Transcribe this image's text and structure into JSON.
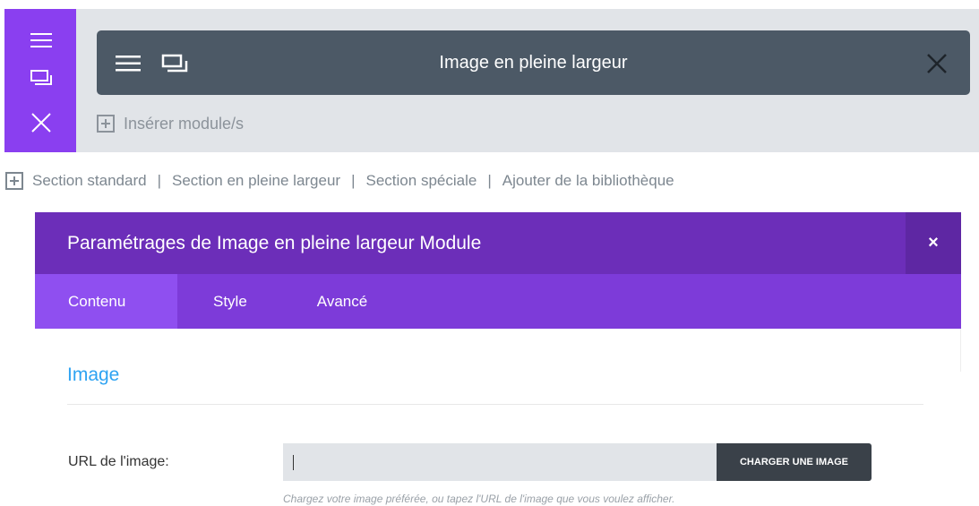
{
  "section": {
    "controls": {
      "menu_icon": "hamburger-icon",
      "duplicate_icon": "duplicate-icon",
      "close_icon": "close-icon"
    },
    "module": {
      "title": "Image en pleine largeur",
      "menu_icon": "hamburger-icon",
      "duplicate_icon": "duplicate-icon",
      "close_icon": "close-icon"
    },
    "insert_label": "Insérer module/s"
  },
  "section_links": {
    "items": [
      "Section standard",
      "Section en pleine largeur",
      "Section spéciale",
      "Ajouter de la bibliothèque"
    ],
    "separator": "|"
  },
  "modal": {
    "title": "Paramétrages de Image en pleine largeur Module",
    "close": "×",
    "tabs": [
      "Contenu",
      "Style",
      "Avancé"
    ],
    "active_tab": "Contenu",
    "section_title": "Image",
    "field": {
      "label": "URL de l'image:",
      "value": "",
      "button": "CHARGER UNE IMAGE",
      "help": "Chargez votre image préférée, ou tapez l'URL de l'image que vous voulez afficher."
    }
  },
  "colors": {
    "accent_purple": "#8a3ff0",
    "header_purple": "#6c2eb9",
    "tabs_purple": "#7d3bd9",
    "module_gray": "#4c5966",
    "section_title_blue": "#2ea3f2"
  }
}
